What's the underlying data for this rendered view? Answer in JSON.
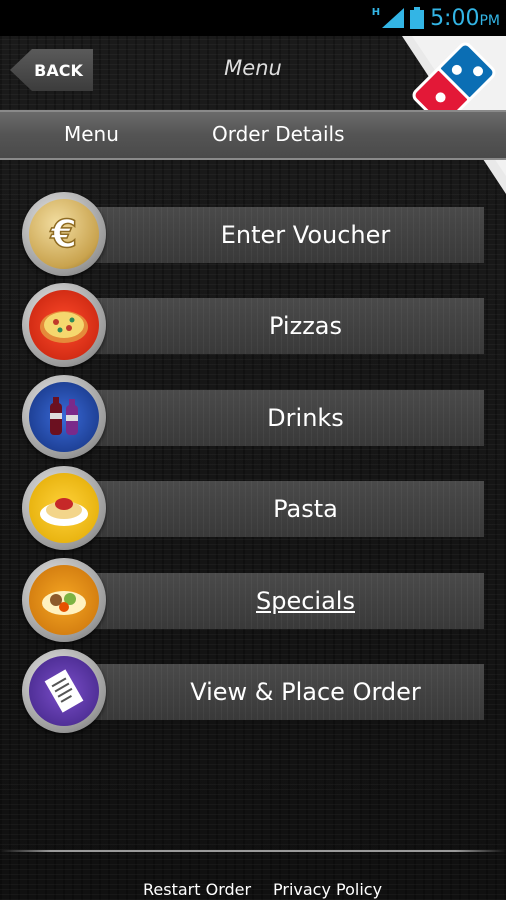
{
  "status_bar": {
    "network": "H",
    "time": "5:00",
    "ampm": "PM"
  },
  "header": {
    "back_label": "BACK",
    "title": "Menu"
  },
  "tabs": [
    {
      "label": "Menu"
    },
    {
      "label": "Order Details"
    }
  ],
  "menu_items": [
    {
      "label": "Enter Voucher",
      "icon": "euro-coin-icon"
    },
    {
      "label": "Pizzas",
      "icon": "pizza-icon"
    },
    {
      "label": "Drinks",
      "icon": "drinks-icon"
    },
    {
      "label": "Pasta",
      "icon": "pasta-icon"
    },
    {
      "label": "Specials",
      "icon": "specials-icon"
    },
    {
      "label": "View & Place Order",
      "icon": "receipt-icon"
    }
  ],
  "footer": {
    "restart_label": "Restart Order",
    "privacy_label": "Privacy Policy"
  },
  "colors": {
    "accent_status": "#33b5e5",
    "logo_red": "#e31837",
    "logo_blue": "#0b6eb4"
  }
}
